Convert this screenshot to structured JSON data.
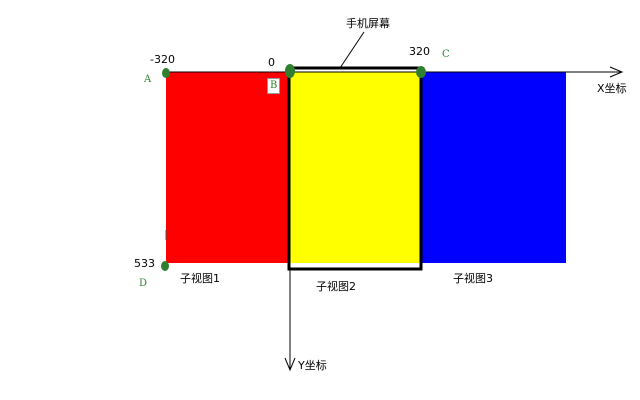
{
  "diagram": {
    "axis_x_label": "X坐标",
    "axis_y_label": "Y坐标",
    "screen_label": "手机屏幕",
    "tick_minus320": "-320",
    "tick_zero": "0",
    "tick_320": "320",
    "tick_533": "533",
    "point_a": "A",
    "point_b": "B",
    "point_c": "C",
    "point_d": "D",
    "subview_1": "子视图1",
    "subview_2": "子视图2",
    "subview_3": "子视图3"
  },
  "colors": {
    "subview_1": "#ff0000",
    "subview_2": "#ffff00",
    "subview_3": "#0000ff",
    "point": "#2f7f2f",
    "axis": "#000000"
  }
}
